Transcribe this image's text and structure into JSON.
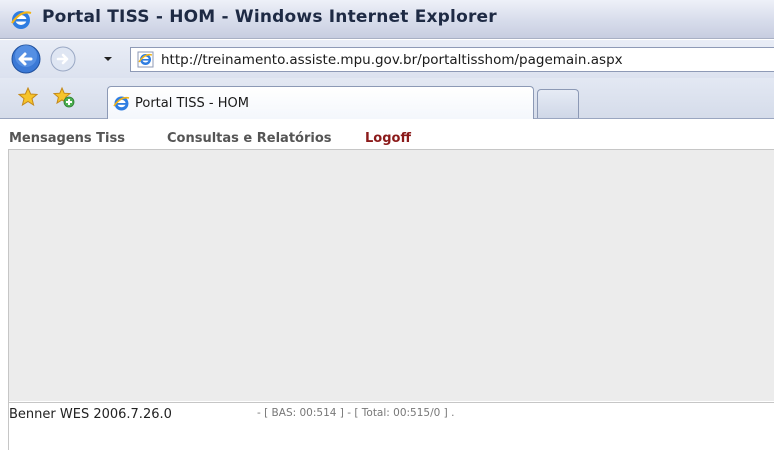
{
  "window": {
    "title": "Portal TISS - HOM - Windows Internet Explorer"
  },
  "address_bar": {
    "url": "http://treinamento.assiste.mpu.gov.br/portaltisshom/pagemain.aspx"
  },
  "tabs": [
    {
      "label": "Portal TISS - HOM",
      "active": true
    }
  ],
  "icons": {
    "browser": "ie-logo-icon",
    "back": "back-arrow-icon",
    "forward": "forward-arrow-icon",
    "favorites": "star-icon",
    "add_favorite": "add-favorite-icon"
  },
  "menu": {
    "items": [
      {
        "label": "Mensagens Tiss"
      },
      {
        "label": "Consultas e Relatórios"
      },
      {
        "label": "Logoff"
      }
    ]
  },
  "footer": {
    "version": "Benner WES 2006.7.26.0",
    "stats": "- [ BAS: 00:514 ] - [ Total: 00:515/0 ] ."
  },
  "colors": {
    "logoff": "#8b1a1a",
    "menu_text": "#555555",
    "content_bg": "#ececec"
  }
}
